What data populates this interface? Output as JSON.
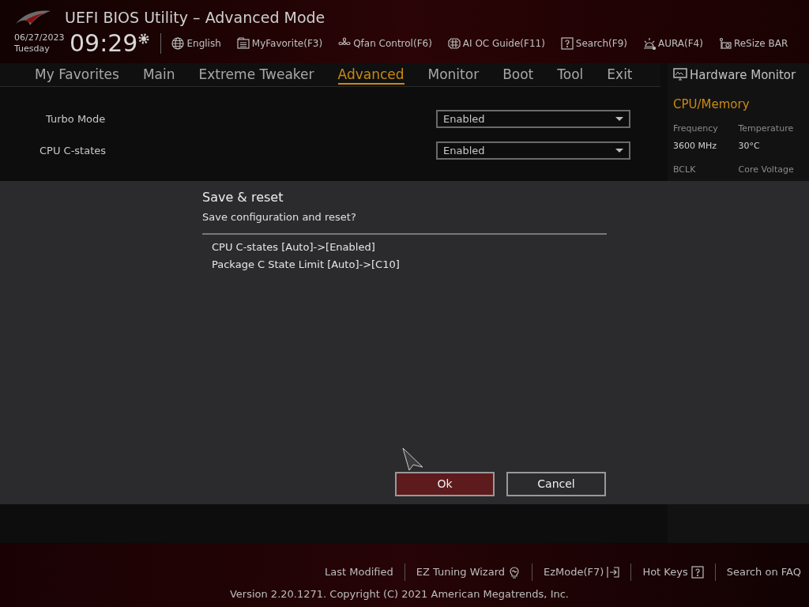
{
  "header": {
    "title": "UEFI BIOS Utility – Advanced Mode",
    "date": "06/27/2023",
    "day": "Tuesday",
    "time": "09:29",
    "toolbar": [
      {
        "kind": "globe",
        "label": "English"
      },
      {
        "kind": "favorite",
        "label": "MyFavorite(F3)"
      },
      {
        "kind": "fan",
        "label": "Qfan Control(F6)"
      },
      {
        "kind": "chip",
        "label": "AI OC Guide(F11)"
      },
      {
        "kind": "help",
        "label": "Search(F9)"
      },
      {
        "kind": "light",
        "label": "AURA(F4)"
      },
      {
        "kind": "card",
        "label": "ReSize BAR"
      }
    ]
  },
  "tabs": [
    {
      "label": "My Favorites",
      "selected": false
    },
    {
      "label": "Main",
      "selected": false
    },
    {
      "label": "Extreme Tweaker",
      "selected": false
    },
    {
      "label": "Advanced",
      "selected": true
    },
    {
      "label": "Monitor",
      "selected": false
    },
    {
      "label": "Boot",
      "selected": false
    },
    {
      "label": "Tool",
      "selected": false
    },
    {
      "label": "Exit",
      "selected": false
    }
  ],
  "settings": [
    {
      "kind": "sub",
      "label": "Turbo Mode",
      "value": "Enabled"
    },
    {
      "kind": "item",
      "label": "CPU C-states",
      "value": "Enabled"
    }
  ],
  "hardware_monitor": {
    "title": "Hardware Monitor",
    "section": "CPU/Memory",
    "fields": [
      {
        "label": "Frequency",
        "value": "3600 MHz"
      },
      {
        "label": "Temperature",
        "value": "30°C"
      },
      {
        "label": "BCLK"
      },
      {
        "label": "Core Voltage"
      }
    ]
  },
  "dialog": {
    "title": "Save & reset",
    "message": "Save configuration and reset?",
    "changes": [
      "CPU C-states [Auto]->[Enabled]",
      "Package C State Limit [Auto]->[C10]"
    ],
    "buttons": [
      {
        "label": "Ok",
        "selected": true
      },
      {
        "label": "Cancel",
        "selected": false
      }
    ]
  },
  "footer": {
    "links": [
      {
        "kind": "text",
        "label": "Last Modified"
      },
      {
        "kind": "bulb",
        "label": "EZ Tuning Wizard"
      },
      {
        "kind": "exit",
        "label": "EzMode(F7)"
      },
      {
        "kind": "help",
        "label": "Hot Keys"
      },
      {
        "kind": "text",
        "label": "Search on FAQ"
      }
    ],
    "version": "Version 2.20.1271. Copyright (C) 2021 American Megatrends, Inc."
  }
}
